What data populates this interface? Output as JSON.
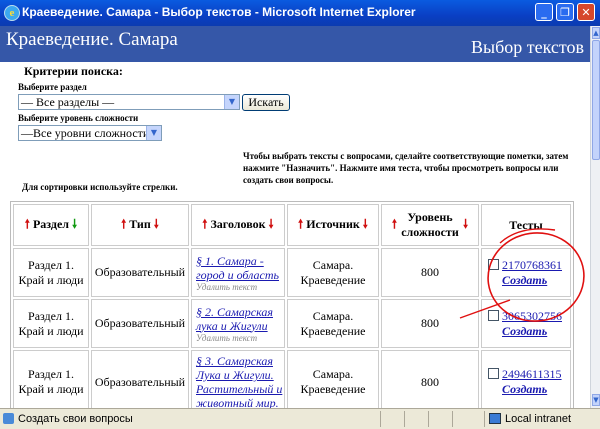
{
  "window": {
    "title": "Краеведение. Самара - Выбор текстов - Microsoft Internet Explorer"
  },
  "header": {
    "site": "Краеведение. Самара",
    "page": "Выбор текстов"
  },
  "criteria": {
    "heading": "Критерии поиска:",
    "section_label": "Выберите раздел",
    "section_value": "— Все разделы —",
    "search_button": "Искать",
    "level_label": "Выберите уровень сложности",
    "level_value": "—Все уровни сложности—"
  },
  "instructions": "Чтобы выбрать тексты с вопросами, сделайте соответствующие пометки, затем нажмите \"Назначить\". Нажмите имя теста, чтобы просмотреть вопросы или создать свои вопросы.",
  "sort_hint": "Для сортировки используйте стрелки.",
  "table": {
    "headers": [
      "Раздел",
      "Тип",
      "Заголовок",
      "Источник",
      "Уровень сложности",
      "Тесты"
    ],
    "rows": [
      {
        "section": "Раздел 1. Край и люди",
        "type": "Образовательный",
        "title": "§ 1. Самара - город и область",
        "delete": "Удалить текст",
        "source": "Самара. Краеведение",
        "level": "800",
        "test": "2170768361",
        "create": "Создать"
      },
      {
        "section": "Раздел 1. Край и люди",
        "type": "Образовательный",
        "title": "§ 2. Самарская лука и Жигули",
        "delete": "Удалить текст",
        "source": "Самара. Краеведение",
        "level": "800",
        "test": "3065302756",
        "create": "Создать"
      },
      {
        "section": "Раздел 1. Край и люди",
        "type": "Образовательный",
        "title": "§ 3. Самарская Лука и Жигули. Растительный и животный мир.",
        "delete": "",
        "source": "Самара. Краеведение",
        "level": "800",
        "test": "2494611315",
        "create": "Создать"
      }
    ]
  },
  "status": {
    "text": "Создать свои вопросы",
    "zone": "Local intranet"
  },
  "colors": {
    "header_bg": "#3557a8",
    "link": "#1a1ab0",
    "arrow_red": "#d01010",
    "arrow_green": "#129a12",
    "annotation": "#e01010"
  }
}
